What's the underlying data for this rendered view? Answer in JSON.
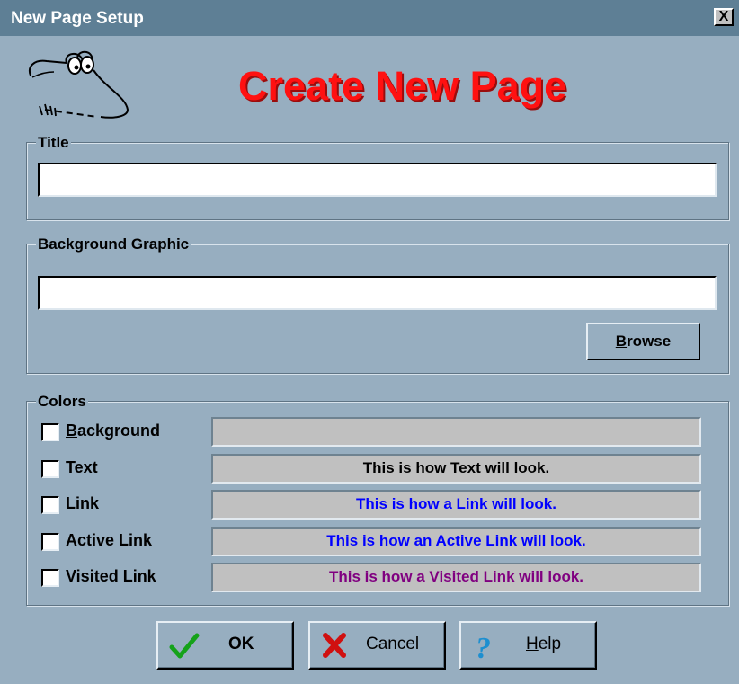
{
  "window": {
    "title": "New Page Setup",
    "close_glyph": "X"
  },
  "header": {
    "logo_icon": "cartoon-face-icon",
    "heading": "Create New Page",
    "heading_color": "#ff1111"
  },
  "title_group": {
    "legend": "Title",
    "value": ""
  },
  "background_group": {
    "legend": "Background Graphic",
    "value": "",
    "browse": {
      "mnemonic": "B",
      "rest": "rowse"
    }
  },
  "colors_group": {
    "legend": "Colors",
    "items": [
      {
        "mnemonic": "B",
        "rest": "ackground",
        "checked": false,
        "preview": "",
        "preview_color": "#000000"
      },
      {
        "mnemonic": "",
        "rest": "Text",
        "checked": false,
        "preview": "This is how Text will look.",
        "preview_color": "#000000"
      },
      {
        "mnemonic": "",
        "rest": "Link",
        "checked": false,
        "preview": "This is how a Link will look.",
        "preview_color": "#0000ff"
      },
      {
        "mnemonic": "",
        "rest": "Active Link",
        "checked": false,
        "preview": "This is how an Active Link will look.",
        "preview_color": "#0000ff"
      },
      {
        "mnemonic": "",
        "rest": "Visited Link",
        "checked": false,
        "preview": "This is how a Visited Link will look.",
        "preview_color": "#800080"
      }
    ]
  },
  "footer": {
    "ok": {
      "label": "OK",
      "icon": "checkmark-icon"
    },
    "cancel": {
      "label": "Cancel",
      "icon": "cancel-x-icon"
    },
    "help": {
      "mnemonic": "H",
      "rest": "elp",
      "icon": "question-mark-icon"
    }
  }
}
